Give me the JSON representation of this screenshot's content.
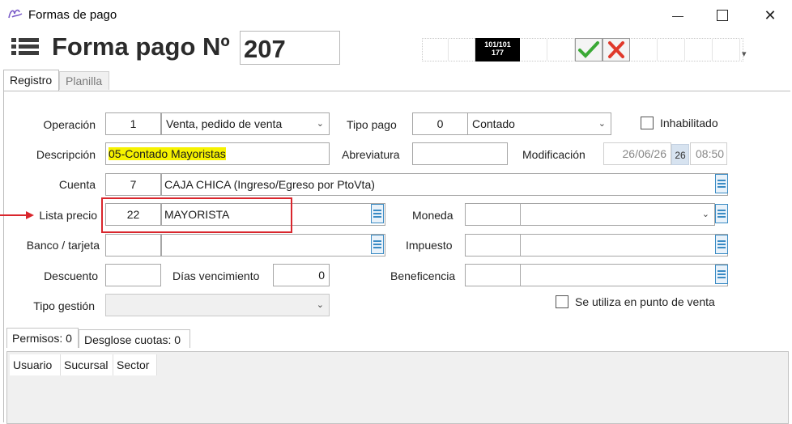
{
  "window": {
    "title": "Formas de pago",
    "minimize_glyph": "—",
    "maximize_glyph": "☐",
    "close_glyph": "✕"
  },
  "header": {
    "title": "Forma pago Nº",
    "number": "207"
  },
  "toolbar": {
    "counter_line1": "101/101",
    "counter_line2": "177",
    "accept_icon": "check-icon",
    "cancel_icon": "x-icon",
    "overflow_glyph": "▾"
  },
  "tabs": [
    {
      "label": "Registro",
      "active": true
    },
    {
      "label": "Planilla",
      "active": false
    }
  ],
  "form": {
    "operacion": {
      "label": "Operación",
      "code": "1",
      "value": "Venta, pedido de venta"
    },
    "tipo_pago": {
      "label": "Tipo pago",
      "code": "0",
      "value": "Contado"
    },
    "inhabilitado": {
      "label": "Inhabilitado",
      "checked": false
    },
    "descripcion": {
      "label": "Descripción",
      "value": "05-Contado Mayoristas",
      "highlight": "#f6f200"
    },
    "abreviatura": {
      "label": "Abreviatura",
      "value": ""
    },
    "modificacion": {
      "label": "Modificación",
      "date": "26/06/26",
      "cal_day": "26",
      "time": "08:50"
    },
    "cuenta": {
      "label": "Cuenta",
      "code": "7",
      "value": "CAJA CHICA (Ingreso/Egreso por PtoVta)"
    },
    "lista_precio": {
      "label": "Lista precio",
      "code": "22",
      "value": "MAYORISTA",
      "annotation_color": "#d9262d"
    },
    "moneda": {
      "label": "Moneda",
      "code": "",
      "value": ""
    },
    "banco": {
      "label": "Banco / tarjeta",
      "code": "",
      "value": ""
    },
    "impuesto": {
      "label": "Impuesto",
      "code": "",
      "value": ""
    },
    "descuento": {
      "label": "Descuento",
      "value": ""
    },
    "dias_vencimiento": {
      "label": "Días vencimiento",
      "value": "0"
    },
    "beneficencia": {
      "label": "Beneficencia",
      "code": "",
      "value": ""
    },
    "tipo_gestion": {
      "label": "Tipo gestión",
      "value": ""
    },
    "punto_venta": {
      "label": "Se utiliza en punto de venta",
      "checked": false
    }
  },
  "subtabs": [
    {
      "label": "Permisos: 0"
    },
    {
      "label": "Desglose cuotas: 0"
    }
  ],
  "grid": {
    "columns": [
      "Usuario",
      "Sucursal",
      "Sector"
    ]
  },
  "colors": {
    "accent": "#3a8bc4",
    "check": "#3aa935",
    "cancel": "#e0392b"
  }
}
